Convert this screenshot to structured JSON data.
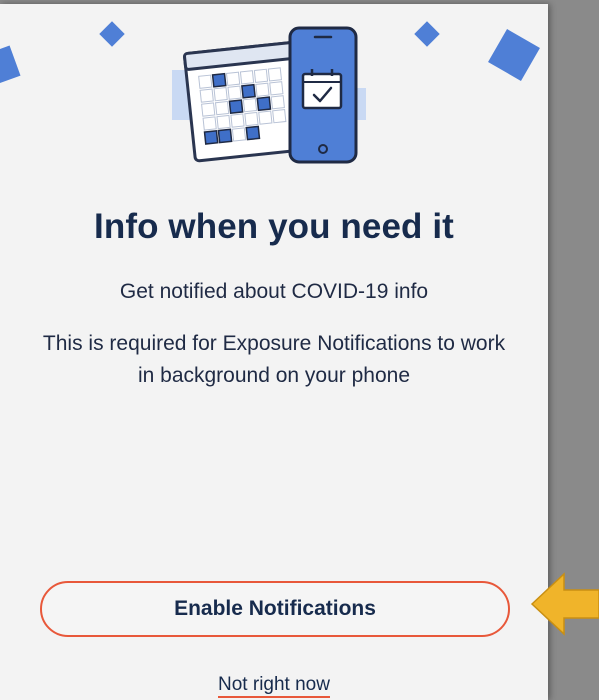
{
  "onboarding": {
    "heading": "Info when you need it",
    "subheading": "Get notified about COVID-19 info",
    "body": "This is required for Exposure Notifications to work in background on your phone",
    "primary_button_label": "Enable Notifications",
    "secondary_link_label": "Not right now"
  },
  "icons": {
    "illustration": "calendar-phone-illustration",
    "confetti": "confetti-diamond-icon",
    "arrow": "pointer-arrow-icon"
  },
  "colors": {
    "background": "#f3f3f3",
    "heading_text": "#172b4d",
    "accent_blue": "#4f7fd6",
    "button_border": "#e8583a",
    "arrow": "#f0b42a"
  }
}
